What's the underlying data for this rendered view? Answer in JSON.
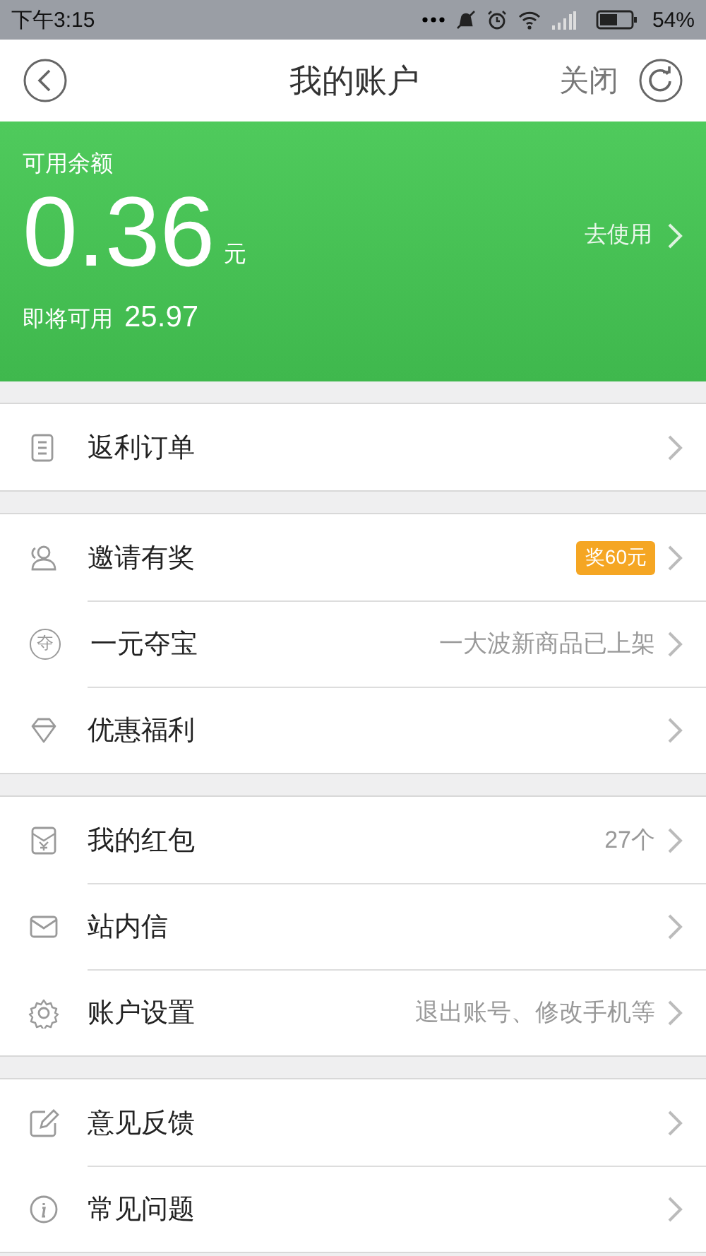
{
  "status_bar": {
    "time": "下午3:15",
    "battery": "54%"
  },
  "header": {
    "title": "我的账户",
    "close": "关闭"
  },
  "balance": {
    "label": "可用余额",
    "amount": "0.36",
    "unit": "元",
    "action": "去使用",
    "pending_label": "即将可用",
    "pending_amount": "25.97"
  },
  "groups": [
    {
      "items": [
        {
          "label": "返利订单"
        }
      ]
    },
    {
      "items": [
        {
          "label": "邀请有奖",
          "badge": "奖60元"
        },
        {
          "label": "一元夺宝",
          "icon_glyph": "夺",
          "hint": "一大波新商品已上架"
        },
        {
          "label": "优惠福利"
        }
      ]
    },
    {
      "items": [
        {
          "label": "我的红包",
          "hint": "27个"
        },
        {
          "label": "站内信"
        },
        {
          "label": "账户设置",
          "hint": "退出账号、修改手机等"
        }
      ]
    },
    {
      "items": [
        {
          "label": "意见反馈"
        },
        {
          "label": "常见问题"
        }
      ]
    }
  ]
}
